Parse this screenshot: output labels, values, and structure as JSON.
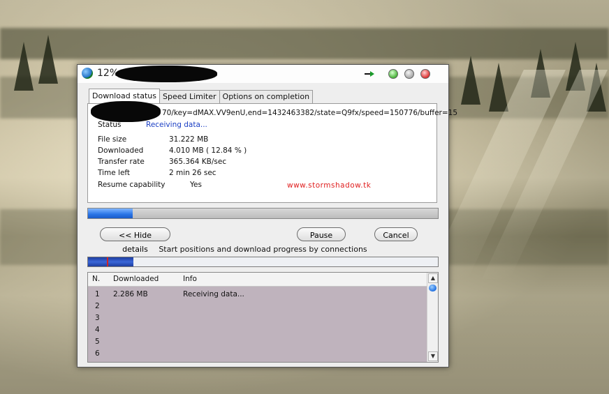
{
  "window": {
    "title": "12%",
    "tabs": [
      "Download status",
      "Speed Limiter",
      "Options on completion"
    ],
    "active_tab": "Download status"
  },
  "details": {
    "url_fragment": "70/key=dMAX.VV9enU,end=1432463382/state=Q9fx/speed=150776/buffer=15",
    "status_label": "Status",
    "status_value": "Receiving data...",
    "rows": [
      {
        "label": "File size",
        "value": "31.222  MB"
      },
      {
        "label": "Downloaded",
        "value": "4.010  MB  ( 12.84 % )"
      },
      {
        "label": "Transfer rate",
        "value": "365.364  KB/sec"
      },
      {
        "label": "Time left",
        "value": "2 min 26 sec"
      }
    ],
    "resume_label": "Resume capability",
    "resume_value": "Yes",
    "ad_text": "www.stormshadow.tk",
    "progress_fraction": 0.1284
  },
  "buttons": {
    "hide_details": "<< Hide details",
    "pause": "Pause",
    "cancel": "Cancel"
  },
  "connections": {
    "caption": "Start positions and download progress by connections",
    "progress_fraction": 0.13,
    "columns": [
      "N.",
      "Downloaded",
      "Info"
    ],
    "rows": [
      {
        "n": "1",
        "downloaded": "2.286  MB",
        "info": "Receiving data..."
      },
      {
        "n": "2",
        "downloaded": "",
        "info": ""
      },
      {
        "n": "3",
        "downloaded": "",
        "info": ""
      },
      {
        "n": "4",
        "downloaded": "",
        "info": ""
      },
      {
        "n": "5",
        "downloaded": "",
        "info": ""
      },
      {
        "n": "6",
        "downloaded": "",
        "info": ""
      }
    ]
  },
  "colors": {
    "progress_blue": "#2a74e6",
    "list_background": "#bfb3bd",
    "status_text": "#1a3ec4",
    "ad_text": "#e02020"
  },
  "icons": [
    "idm-app-icon",
    "arrow-icon",
    "minimize-icon",
    "maximize-icon",
    "close-icon",
    "scroll-up-icon",
    "scroll-down-icon"
  ]
}
